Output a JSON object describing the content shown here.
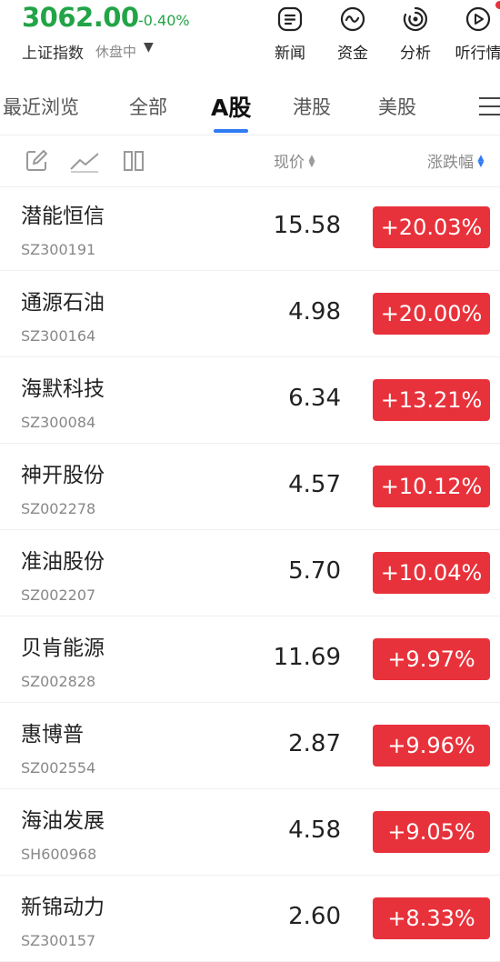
{
  "index": {
    "value": "3062.00",
    "change": "-0.40%",
    "name": "上证指数",
    "status": "休盘中",
    "caret": "▼",
    "color_down": "#22a447"
  },
  "header_buttons": [
    {
      "label": "新闻",
      "icon": "news-icon"
    },
    {
      "label": "资金",
      "icon": "fund-flow-icon"
    },
    {
      "label": "分析",
      "icon": "analysis-icon"
    },
    {
      "label": "听行情",
      "icon": "play-audio-icon"
    }
  ],
  "tabs": [
    "最近浏览",
    "全部",
    "A股",
    "港股",
    "美股"
  ],
  "active_tab": "A股",
  "toolbar": {
    "price_header": "现价",
    "change_header": "涨跌幅",
    "sort_glyph": "▲▼"
  },
  "stocks": [
    {
      "name": "潜能恒信",
      "code": "SZ300191",
      "price": "15.58",
      "change": "+20.03%"
    },
    {
      "name": "通源石油",
      "code": "SZ300164",
      "price": "4.98",
      "change": "+20.00%"
    },
    {
      "name": "海默科技",
      "code": "SZ300084",
      "price": "6.34",
      "change": "+13.21%"
    },
    {
      "name": "神开股份",
      "code": "SZ002278",
      "price": "4.57",
      "change": "+10.12%"
    },
    {
      "name": "准油股份",
      "code": "SZ002207",
      "price": "5.70",
      "change": "+10.04%"
    },
    {
      "name": "贝肯能源",
      "code": "SZ002828",
      "price": "11.69",
      "change": "+9.97%"
    },
    {
      "name": "惠博普",
      "code": "SZ002554",
      "price": "2.87",
      "change": "+9.96%"
    },
    {
      "name": "海油发展",
      "code": "SH600968",
      "price": "4.58",
      "change": "+9.05%"
    },
    {
      "name": "新锦动力",
      "code": "SZ300157",
      "price": "2.60",
      "change": "+8.33%"
    }
  ],
  "colors": {
    "up_badge": "#e8323b",
    "accent": "#2f7bf2"
  }
}
